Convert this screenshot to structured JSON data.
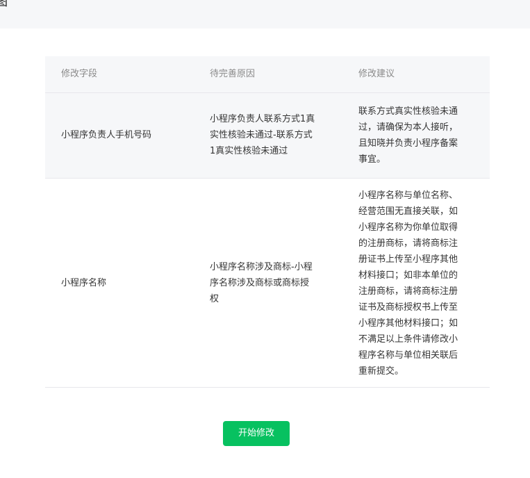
{
  "header": {
    "title_fragment": "图"
  },
  "table": {
    "columns": [
      "修改字段",
      "待完善原因",
      "修改建议"
    ],
    "rows": [
      {
        "field": "小程序负责人手机号码",
        "reason": "小程序负责人联系方式1真\n实性核验未通过-联系方式\n1真实性核验未通过",
        "suggestion": "联系方式真实性核验未通\n过，请确保为本人接听，\n且知晓并负责小程序备案\n事宜。"
      },
      {
        "field": "小程序名称",
        "reason": "小程序名称涉及商标-小程\n序名称涉及商标或商标授\n权",
        "suggestion": "小程序名称与单位名称、\n经营范围无直接关联，如\n小程序名称为你单位取得\n的注册商标，请将商标注\n册证书上传至小程序其他\n材料接口；如非本单位的\n注册商标，请将商标注册\n证书及商标授权书上传至\n小程序其他材料接口；如\n不满足以上条件请修改小\n程序名称与单位相关联后\n重新提交。"
      }
    ]
  },
  "actions": {
    "start_edit_label": "开始修改"
  },
  "colors": {
    "accent": "#07c160",
    "header_bg": "#f6f7f9"
  }
}
